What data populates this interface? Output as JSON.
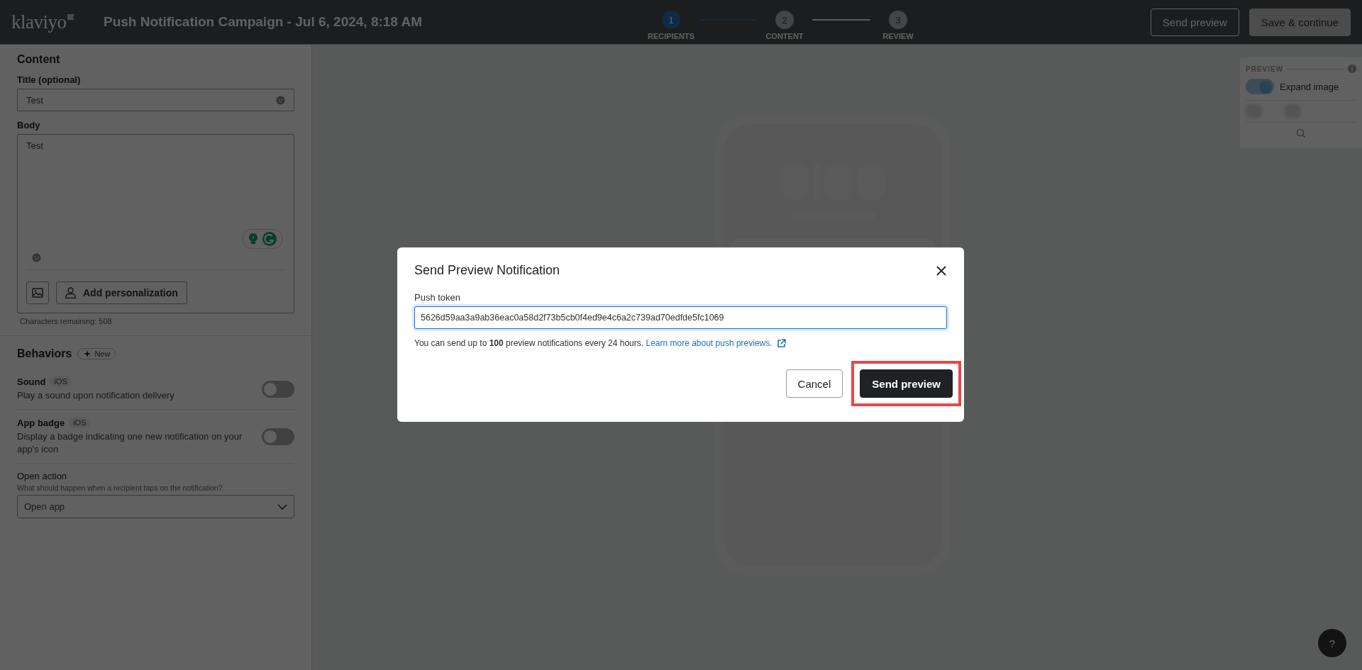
{
  "header": {
    "logo": "klaviyo",
    "campaign_title": "Push Notification Campaign - Jul 6, 2024, 8:18 AM",
    "steps": [
      {
        "number": "1",
        "label": "RECIPIENTS",
        "selected": true
      },
      {
        "number": "2",
        "label": "CONTENT",
        "selected": false
      },
      {
        "number": "3",
        "label": "REVIEW",
        "selected": false
      }
    ],
    "buttons": [
      {
        "label": "Send preview",
        "kind": "outline"
      },
      {
        "label": "Save & continue",
        "kind": "filled"
      }
    ]
  },
  "content": {
    "heading": "Content",
    "title_field": {
      "label": "Title (optional)",
      "value": "Test"
    },
    "body_field": {
      "label": "Body",
      "value": "Test"
    },
    "personalization_button": "Add personalization",
    "characters_remaining": "Characters remaining: 508"
  },
  "behaviors": {
    "heading": "Behaviors",
    "badge": "New",
    "toggles": [
      {
        "label": "Sound",
        "platform": "iOS",
        "description": "Play a sound upon notification delivery",
        "on": false
      },
      {
        "label": "App badge",
        "platform": "iOS",
        "description": "Display a badge indicating one new notification on your app's icon",
        "on": false
      }
    ],
    "open_action": {
      "label": "Open action",
      "hint": "What should happen when a recipient taps on the notification?",
      "value": "Open app"
    }
  },
  "preview_panel": {
    "heading": "PREVIEW",
    "expand_image": {
      "label": "Expand image",
      "on": true
    }
  },
  "help_button": "?",
  "modal": {
    "title": "Send Preview Notification",
    "field_label": "Push token",
    "token": "5626d59aa3a9ab36eac0a58d2f73b5cb0f4ed9e4c6a2c739ad70edfde5fc1069",
    "note": "You can send up to **100** preview notifications every 24 hours.",
    "link": "Learn more about push previews.",
    "buttons": [
      {
        "label": "Cancel",
        "kind": "secondary",
        "highlighted": false
      },
      {
        "label": "Send preview",
        "kind": "primary",
        "highlighted": true
      }
    ]
  }
}
